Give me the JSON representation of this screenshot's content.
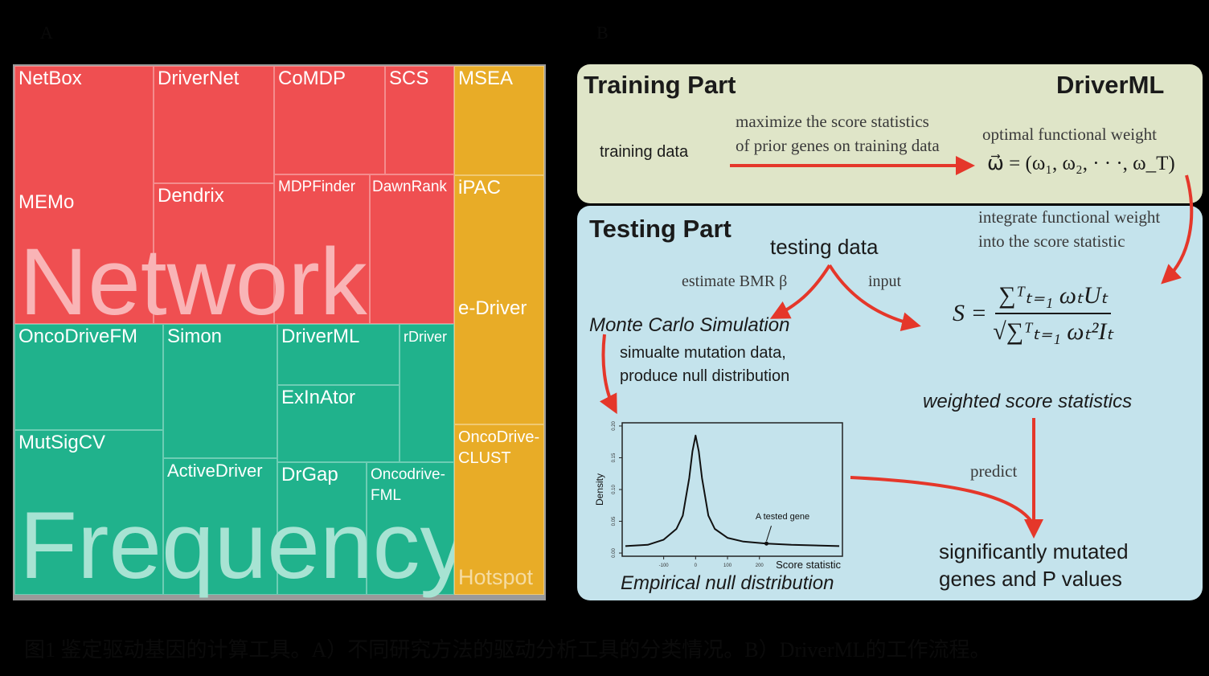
{
  "panel_a": {
    "label": "A",
    "groups": {
      "network": {
        "label": "Network",
        "color": "#ef4f51"
      },
      "frequency": {
        "label": "Frequency",
        "color": "#20b28c"
      },
      "hotspot": {
        "label": "Hotspot",
        "color": "#e8ac27"
      }
    },
    "network_tools": [
      "NetBox",
      "MEMo",
      "DriverNet",
      "Dendrix",
      "CoMDP",
      "SCS",
      "MDPFinder",
      "DawnRank"
    ],
    "frequency_tools": [
      "OncoDriveFM",
      "MutSigCV",
      "Simon",
      "ActiveDriver",
      "DriverML",
      "ExInAtor",
      "rDriver",
      "DrGap",
      "Oncodrive-\nFML"
    ],
    "hotspot_tools": [
      "MSEA",
      "iPAC",
      "e-Driver",
      "OncoDrive-\nCLUST"
    ]
  },
  "panel_b": {
    "label": "B",
    "training": {
      "title": "Training Part",
      "brand": "DriverML",
      "input": "training data",
      "step_line1": "maximize the score statistics",
      "step_line2": "of prior genes on training data",
      "output_label": "optimal functional weight",
      "output_formula": "ω⃗ = (ω₁, ω₂, · · ·, ω_T)",
      "color": "#dfe5c8"
    },
    "testing": {
      "title": "Testing Part",
      "color": "#c4e3ec",
      "integrate_line1": "integrate functional weight",
      "integrate_line2": "into the score statistic",
      "input_data": "testing data",
      "branch_left": "estimate BMR β",
      "branch_right": "input",
      "simulation_title": "Monte Carlo Simulation",
      "simulation_line1": "simualte mutation data,",
      "simulation_line2": "produce null distribution",
      "formula_lhs": "S =",
      "formula_num": "∑ᵀₜ₌₁ ωₜUₜ",
      "formula_den": "√∑ᵀₜ₌₁ ωₜ²Iₜ",
      "statistic_label": "weighted score statistics",
      "predict_label": "predict",
      "result_line1": "significantly mutated",
      "result_line2": "genes and P values",
      "null_label": "Empirical null distribution"
    },
    "arrow_color": "#e5372a"
  },
  "chart_data": {
    "type": "line",
    "xlabel": "Score statistic",
    "ylabel": "Density",
    "x_ticks": [
      "-100",
      "0",
      "100",
      "200"
    ],
    "y_ticks": [
      "0.00",
      "0.05",
      "0.10",
      "0.15",
      "0.20"
    ],
    "xlim": [
      -230,
      460
    ],
    "ylim": [
      -0.005,
      0.205
    ],
    "series": [
      {
        "x": [
          -220,
          -150,
          -100,
          -60,
          -40,
          -20,
          -10,
          0,
          10,
          20,
          40,
          60,
          100,
          150,
          222,
          300,
          450
        ],
        "values": [
          0.011,
          0.013,
          0.021,
          0.038,
          0.059,
          0.118,
          0.16,
          0.185,
          0.16,
          0.118,
          0.059,
          0.038,
          0.024,
          0.018,
          0.015,
          0.013,
          0.011
        ]
      }
    ],
    "annotation": {
      "text": "A tested gene",
      "x": 222,
      "y": 0.015
    }
  },
  "caption": "图1  鉴定驱动基因的计算工具。A）不同研究方法的驱动分析工具的分类情况。B）DriverML的工作流程。"
}
